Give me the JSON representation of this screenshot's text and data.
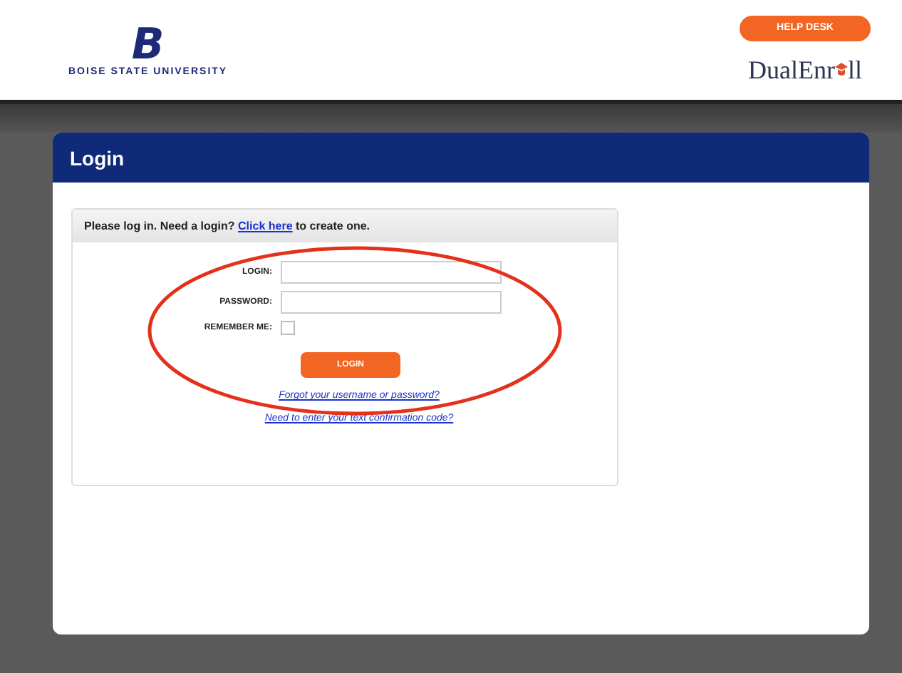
{
  "header": {
    "logo_letter": "B",
    "university": "BOISE STATE UNIVERSITY",
    "help_button": "HELP DESK",
    "brand_start": "DualEnr",
    "brand_end": "ll"
  },
  "panel": {
    "title": "Login",
    "intro_before": "Please log in. Need a login? ",
    "intro_link": "Click here",
    "intro_after": " to create one.",
    "fields": [
      {
        "label": "LOGIN:",
        "kind": "text"
      },
      {
        "label": "PASSWORD:",
        "kind": "password"
      },
      {
        "label": "REMEMBER ME:",
        "kind": "checkbox",
        "checked": false
      }
    ],
    "submit": "LOGIN",
    "links": [
      "Forgot your username or password?",
      "Need to enter your text confirmation code?"
    ]
  }
}
